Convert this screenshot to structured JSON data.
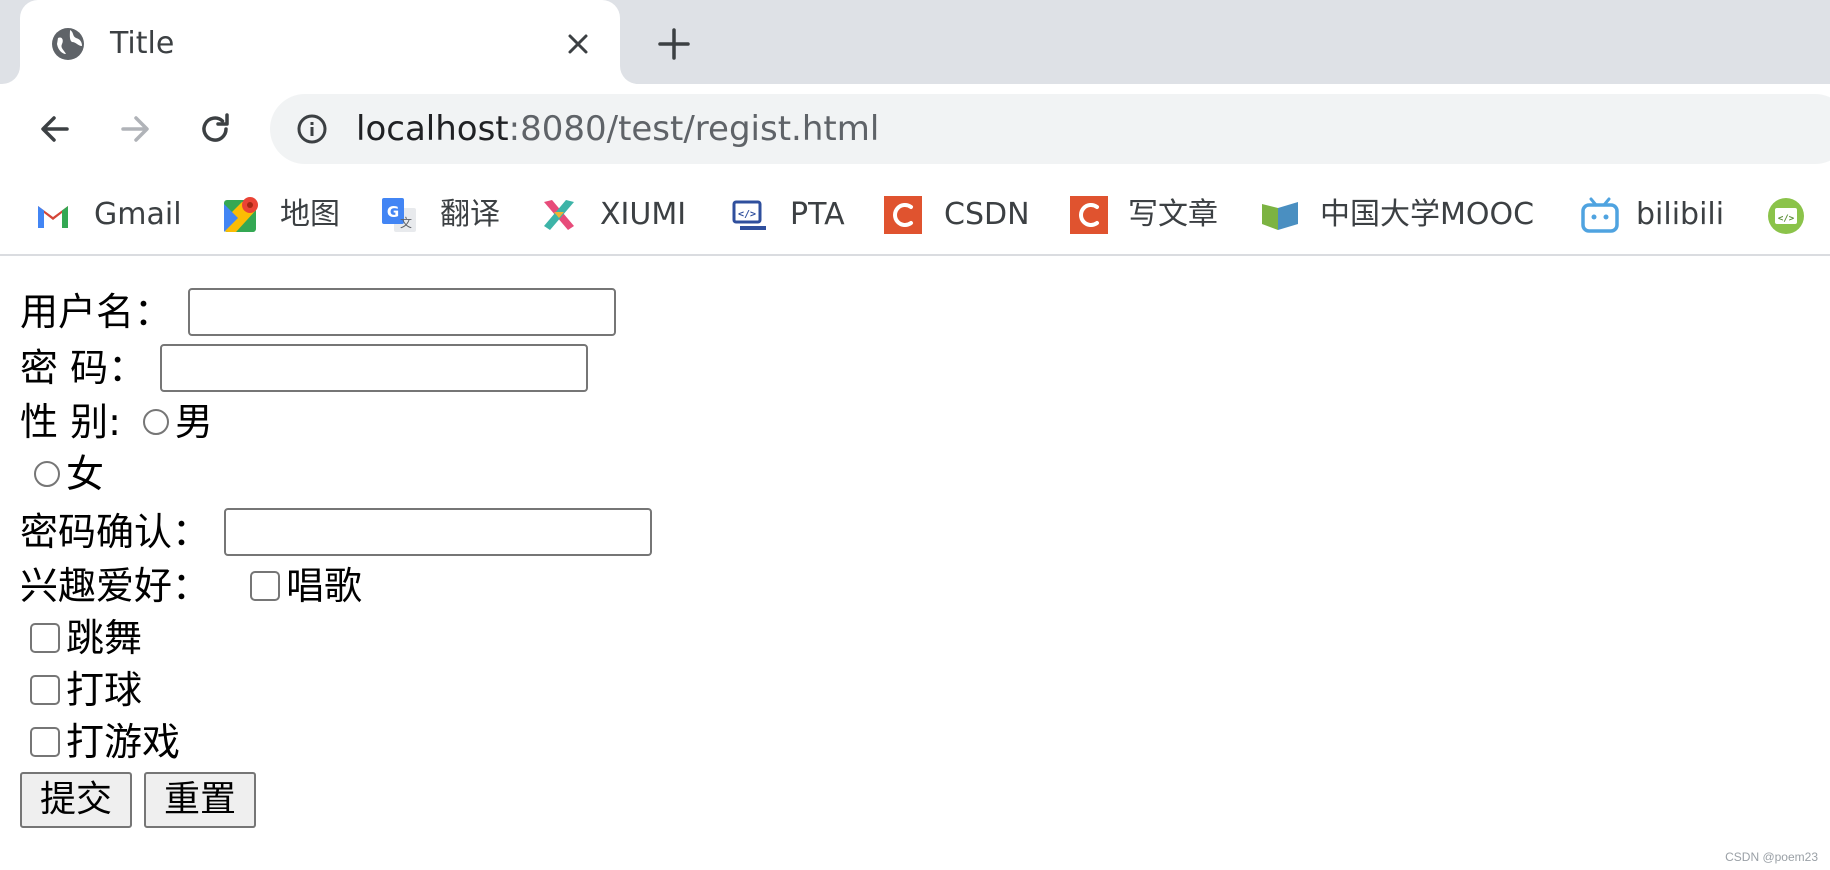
{
  "browser": {
    "tab": {
      "title": "Title"
    },
    "url": {
      "host": "localhost",
      "path": ":8080/test/regist.html"
    },
    "bookmarks": [
      {
        "label": "Gmail",
        "icon": "gmail-icon"
      },
      {
        "label": "地图",
        "icon": "maps-icon"
      },
      {
        "label": "翻译",
        "icon": "translate-icon"
      },
      {
        "label": "XIUMI",
        "icon": "xiumi-icon"
      },
      {
        "label": "PTA",
        "icon": "pta-icon"
      },
      {
        "label": "CSDN",
        "icon": "csdn-icon"
      },
      {
        "label": "写文章",
        "icon": "csdn-icon"
      },
      {
        "label": "中国大学MOOC",
        "icon": "mooc-icon"
      },
      {
        "label": "bilibili",
        "icon": "bilibili-icon"
      }
    ]
  },
  "form": {
    "username_label": "用户名：",
    "password_label": "密 码：",
    "gender_label": "性 别:",
    "gender_options": [
      "男",
      "女"
    ],
    "confirm_label": "密码确认：",
    "hobby_label": "兴趣爱好：",
    "hobbies": [
      "唱歌",
      "跳舞",
      "打球",
      "打游戏"
    ],
    "submit_label": "提交",
    "reset_label": "重置"
  },
  "watermark": "CSDN @poem23",
  "colors": {
    "tabstrip": "#dee1e6",
    "omnibox": "#f1f3f4",
    "csdn": "#e0532f"
  }
}
